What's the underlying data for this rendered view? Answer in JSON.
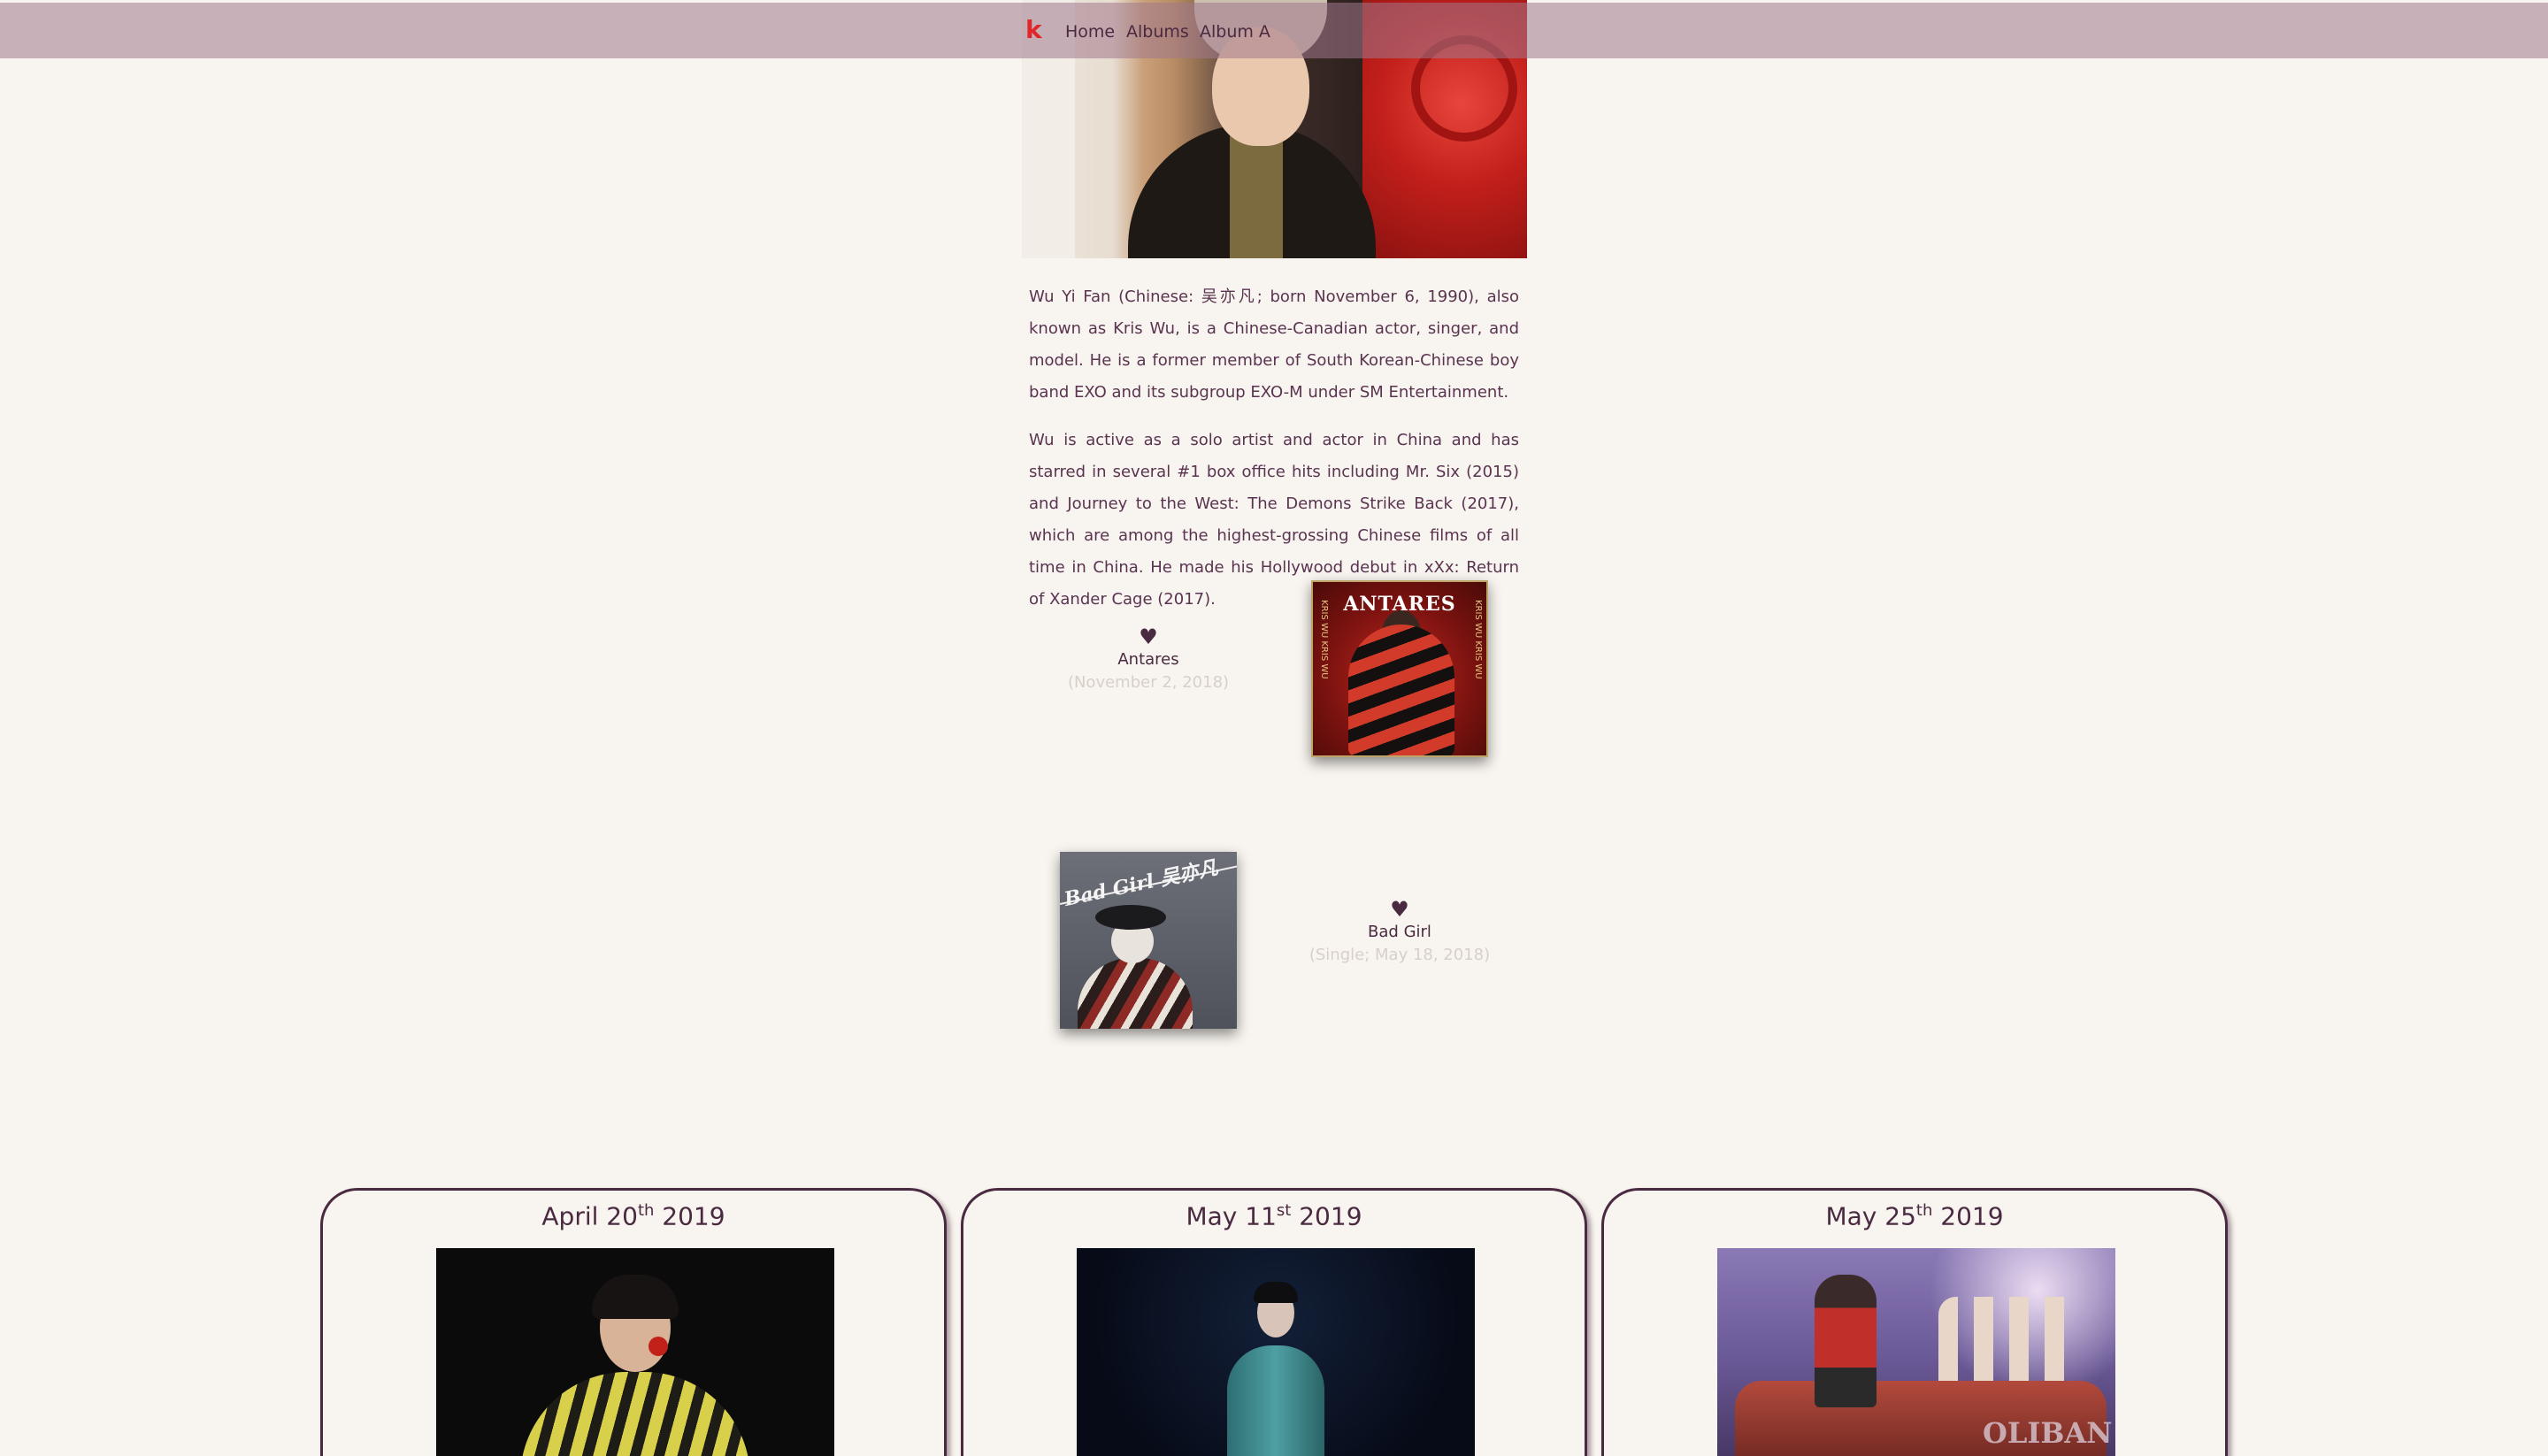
{
  "nav": {
    "brand": "k",
    "links": [
      "Home",
      "Albums",
      "Album A"
    ]
  },
  "bio": {
    "paragraphs": [
      "Wu Yi Fan (Chinese: 吴亦凡; born November 6, 1990), also known as Kris Wu, is a Chinese-Canadian actor, singer, and model. He is a former member of South Korean-Chinese boy band EXO and its subgroup EXO-M under SM Entertainment.",
      "Wu is active as a solo artist and actor in China and has starred in several #1 box office hits including Mr. Six (2015) and Journey to the West: The Demons Strike Back (2017), which are among the highest-grossing Chinese films of all time in China. He made his Hollywood debut in xXx: Return of Xander Cage (2017)."
    ]
  },
  "albums": [
    {
      "heart": "♥",
      "name": "Antares",
      "date": "(November 2, 2018)",
      "cover_title": "ANTARES",
      "cover_side": "KRIS WU KRIS WU"
    },
    {
      "heart": "♥",
      "name": "Bad Girl",
      "date": "(Single; May 18, 2018)",
      "cover_title": "Bad Girl 吴亦凡"
    }
  ],
  "tour": [
    {
      "month_day": "April 20",
      "suffix": "th",
      "year": " 2019"
    },
    {
      "month_day": "May 11",
      "suffix": "st",
      "year": " 2019"
    },
    {
      "month_day": "May 25",
      "suffix": "th",
      "year": " 2019",
      "sign": "OLIBAN"
    }
  ],
  "colors": {
    "background": "#f8f4ef",
    "nav_bar": "#a0788c",
    "text": "#4a2a40",
    "brand": "#e0262a",
    "muted": "#d8cfc9"
  }
}
